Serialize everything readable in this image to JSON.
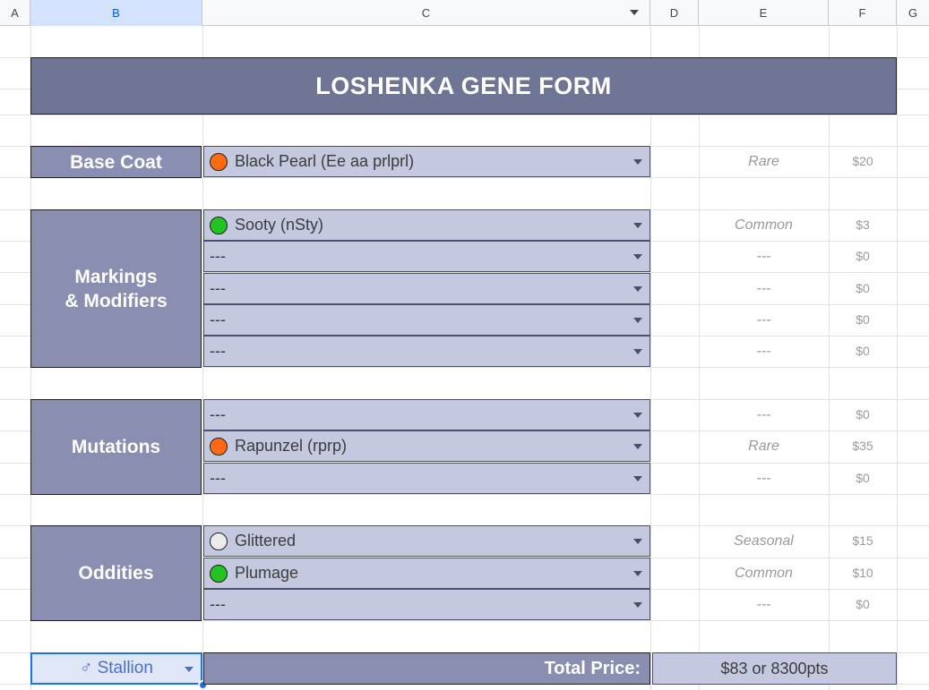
{
  "columns": [
    "A",
    "B",
    "C",
    "D",
    "E",
    "F",
    "G"
  ],
  "title": "LOSHENKA GENE FORM",
  "colors": {
    "rare": "#ff6a13",
    "common": "#22c322",
    "seasonal": "#ececec",
    "header": "#6f7594",
    "label": "#8a8fb2",
    "cell": "#c5c9e0"
  },
  "sections": {
    "base_coat": {
      "label": "Base Coat",
      "rows": [
        {
          "value": "Black Pearl (Ee aa prlprl)",
          "dot": "rare",
          "rarity": "Rare",
          "price": "$20"
        }
      ]
    },
    "markings": {
      "label_line1": "Markings",
      "label_line2": "& Modifiers",
      "rows": [
        {
          "value": "Sooty (nSty)",
          "dot": "common",
          "rarity": "Common",
          "price": "$3"
        },
        {
          "value": "---",
          "dot": null,
          "rarity": "---",
          "price": "$0"
        },
        {
          "value": "---",
          "dot": null,
          "rarity": "---",
          "price": "$0"
        },
        {
          "value": "---",
          "dot": null,
          "rarity": "---",
          "price": "$0"
        },
        {
          "value": "---",
          "dot": null,
          "rarity": "---",
          "price": "$0"
        }
      ]
    },
    "mutations": {
      "label": "Mutations",
      "rows": [
        {
          "value": "---",
          "dot": null,
          "rarity": "---",
          "price": "$0"
        },
        {
          "value": "Rapunzel (rprp)",
          "dot": "rare",
          "rarity": "Rare",
          "price": "$35"
        },
        {
          "value": "---",
          "dot": null,
          "rarity": "---",
          "price": "$0"
        }
      ]
    },
    "oddities": {
      "label": "Oddities",
      "rows": [
        {
          "value": "Glittered",
          "dot": "seasonal",
          "rarity": "Seasonal",
          "price": "$15"
        },
        {
          "value": "Plumage",
          "dot": "common",
          "rarity": "Common",
          "price": "$10"
        },
        {
          "value": "---",
          "dot": null,
          "rarity": "---",
          "price": "$0"
        }
      ]
    }
  },
  "footer": {
    "gender": "♂ Stallion",
    "total_label": "Total Price:",
    "total_value": "$83 or 8300pts"
  }
}
